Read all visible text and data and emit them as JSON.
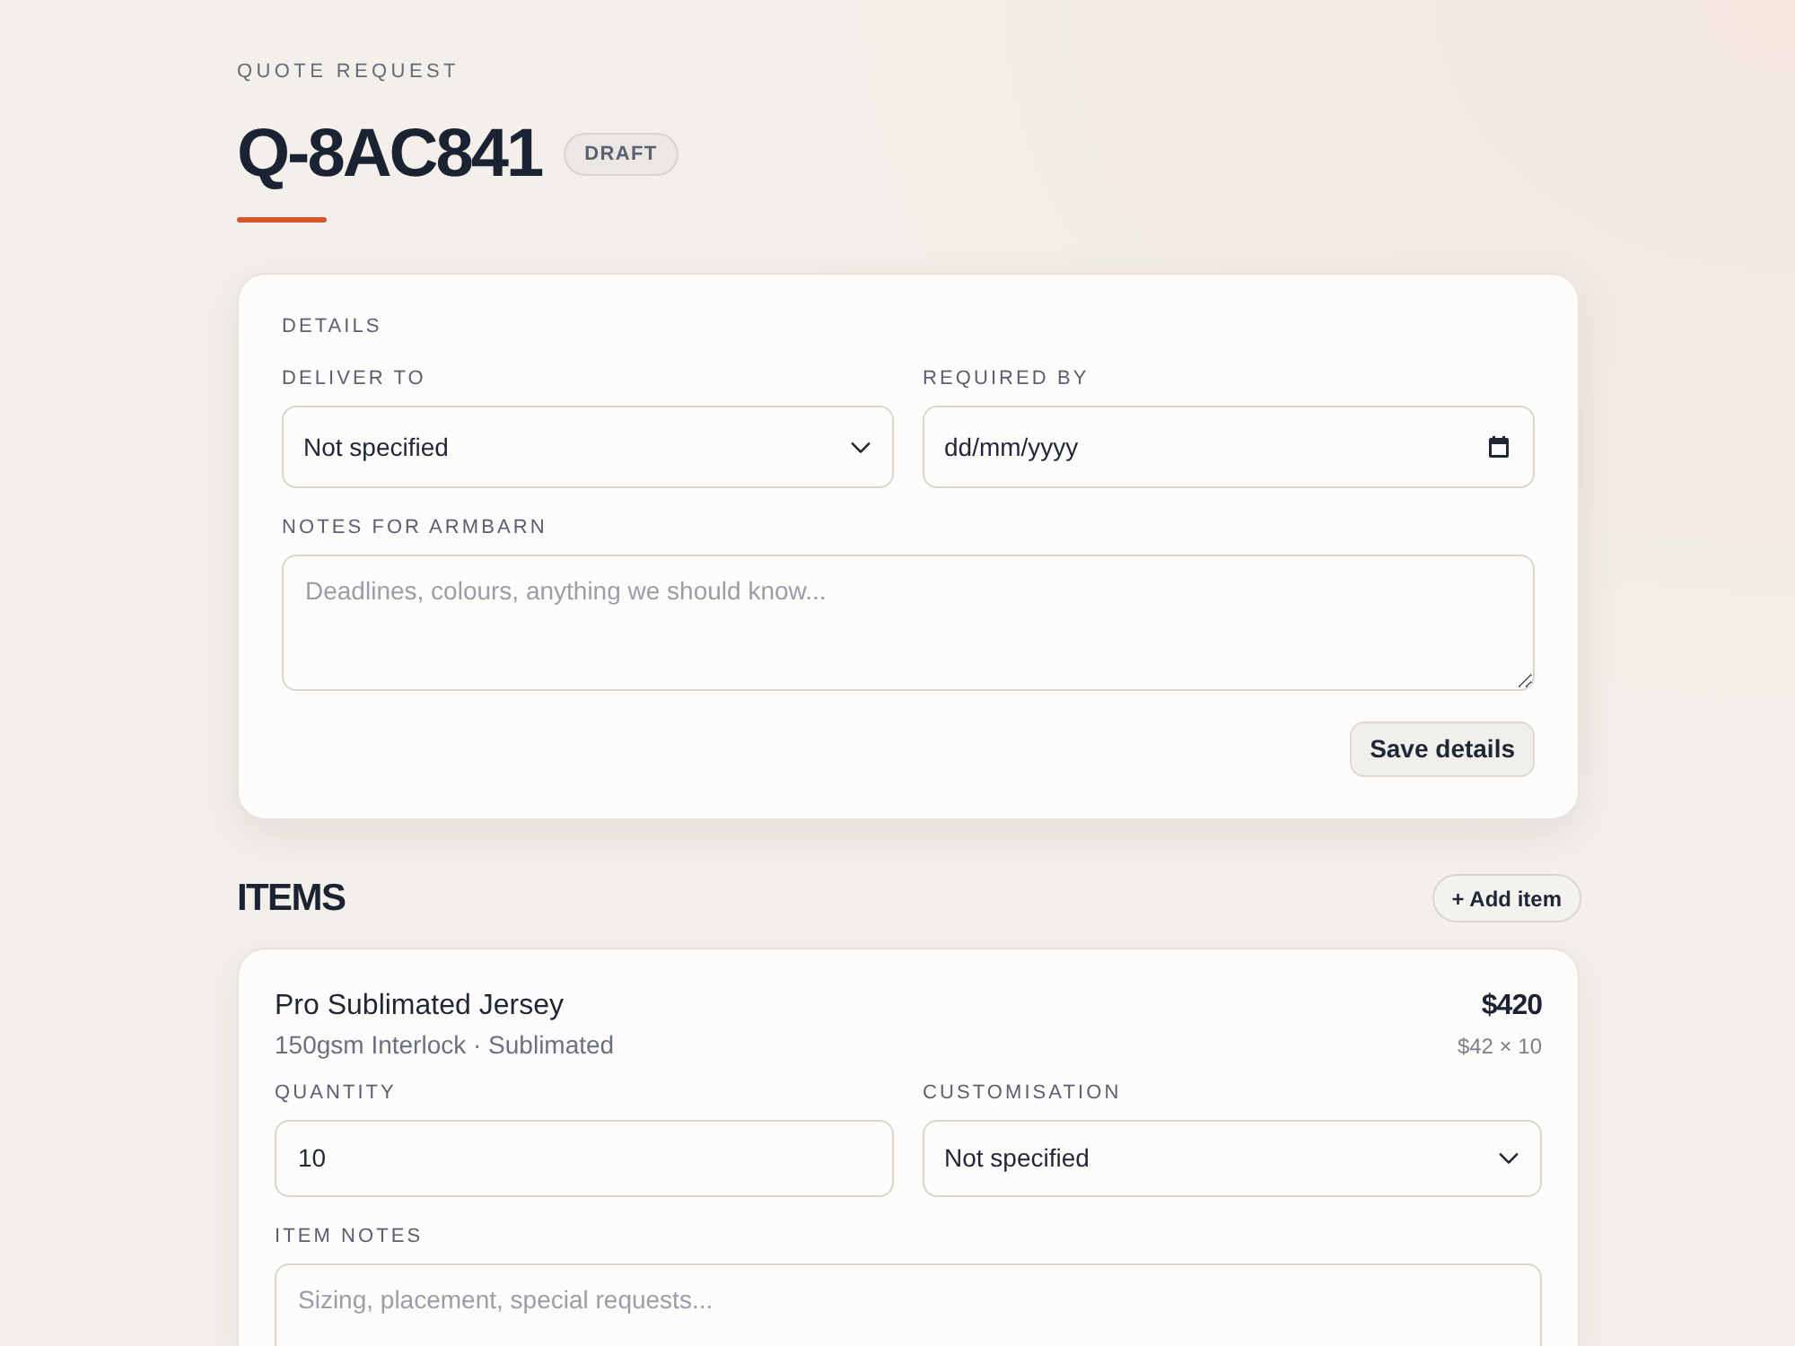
{
  "header": {
    "eyebrow": "QUOTE REQUEST",
    "title": "Q-8AC841",
    "status": "DRAFT"
  },
  "details": {
    "heading": "DETAILS",
    "deliver_to": {
      "label": "DELIVER TO",
      "value": "Not specified"
    },
    "required_by": {
      "label": "REQUIRED BY",
      "value": "dd/mm/yyyy"
    },
    "notes": {
      "label": "NOTES FOR ARMBARN",
      "placeholder": "Deadlines, colours, anything we should know..."
    },
    "save_button": "Save details"
  },
  "items_section": {
    "heading": "ITEMS",
    "add_button": "+ Add item",
    "items": [
      {
        "name": "Pro Sublimated Jersey",
        "spec": "150gsm Interlock · Sublimated",
        "total": "$420",
        "unit_calc": "$42 × 10",
        "quantity": {
          "label": "QUANTITY",
          "value": "10"
        },
        "customisation": {
          "label": "CUSTOMISATION",
          "value": "Not specified"
        },
        "notes": {
          "label": "ITEM NOTES",
          "placeholder": "Sizing, placement, special requests..."
        }
      }
    ]
  }
}
